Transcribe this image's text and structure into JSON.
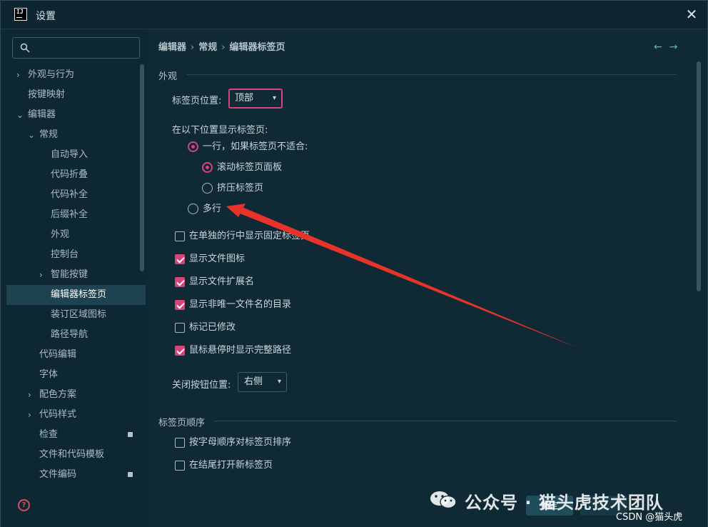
{
  "window": {
    "title": "设置",
    "app_icon_text": "IJ"
  },
  "sidebar": {
    "search": {
      "value": "",
      "placeholder": ""
    },
    "items": [
      {
        "label": "外观与行为",
        "expand": "collapsed"
      },
      {
        "label": "按键映射",
        "expand": "none"
      },
      {
        "label": "编辑器",
        "expand": "expanded"
      },
      {
        "label": "常规",
        "expand": "expanded"
      },
      {
        "label": "自动导入",
        "expand": "none"
      },
      {
        "label": "代码折叠",
        "expand": "none"
      },
      {
        "label": "代码补全",
        "expand": "none"
      },
      {
        "label": "后缀补全",
        "expand": "none"
      },
      {
        "label": "外观",
        "expand": "none"
      },
      {
        "label": "控制台",
        "expand": "none"
      },
      {
        "label": "智能按键",
        "expand": "collapsed"
      },
      {
        "label": "编辑器标签页",
        "expand": "none",
        "selected": true
      },
      {
        "label": "装订区域图标",
        "expand": "none"
      },
      {
        "label": "路径导航",
        "expand": "none"
      },
      {
        "label": "代码编辑",
        "expand": "none"
      },
      {
        "label": "字体",
        "expand": "none"
      },
      {
        "label": "配色方案",
        "expand": "collapsed"
      },
      {
        "label": "代码样式",
        "expand": "collapsed"
      },
      {
        "label": "检查",
        "expand": "none",
        "lock": true
      },
      {
        "label": "文件和代码模板",
        "expand": "none"
      },
      {
        "label": "文件编码",
        "expand": "none",
        "lock": true
      }
    ]
  },
  "breadcrumb": [
    "编辑器",
    "常规",
    "编辑器标签页"
  ],
  "nav": {
    "back": "←",
    "forward": "→"
  },
  "appearance": {
    "title": "外观",
    "tab_position_label": "标签页位置:",
    "tab_position_value": "顶部",
    "show_tabs_in_label": "在以下位置显示标签页:",
    "radio_single_row": "一行，如果标签页不适合:",
    "radio_scroll": "滚动标签页面板",
    "radio_squeeze": "挤压标签页",
    "radio_multi_row": "多行",
    "check_pinned_separate": "在单独的行中显示固定标签页",
    "check_file_icon": "显示文件图标",
    "check_file_ext": "显示文件扩展名",
    "check_dir_nonunique": "显示非唯一文件名的目录",
    "check_mark_modified": "标记已修改",
    "check_full_path_hover": "鼠标悬停时显示完整路径",
    "close_button_label": "关闭按钮位置:",
    "close_button_value": "右侧"
  },
  "tab_order": {
    "title": "标签页顺序",
    "check_sort_alpha": "按字母顺序对标签页排序",
    "check_open_at_end": "在结尾打开新标签页"
  },
  "buttons": {
    "ok": "确定"
  },
  "watermark": {
    "text": "公众号 · 猫头虎技术团队",
    "csdn": "CSDN @猫头虎"
  },
  "colors": {
    "accent": "#d6457a",
    "background": "#0f2a35",
    "selected": "#1e4250",
    "annotation_arrow": "#e8332a"
  }
}
